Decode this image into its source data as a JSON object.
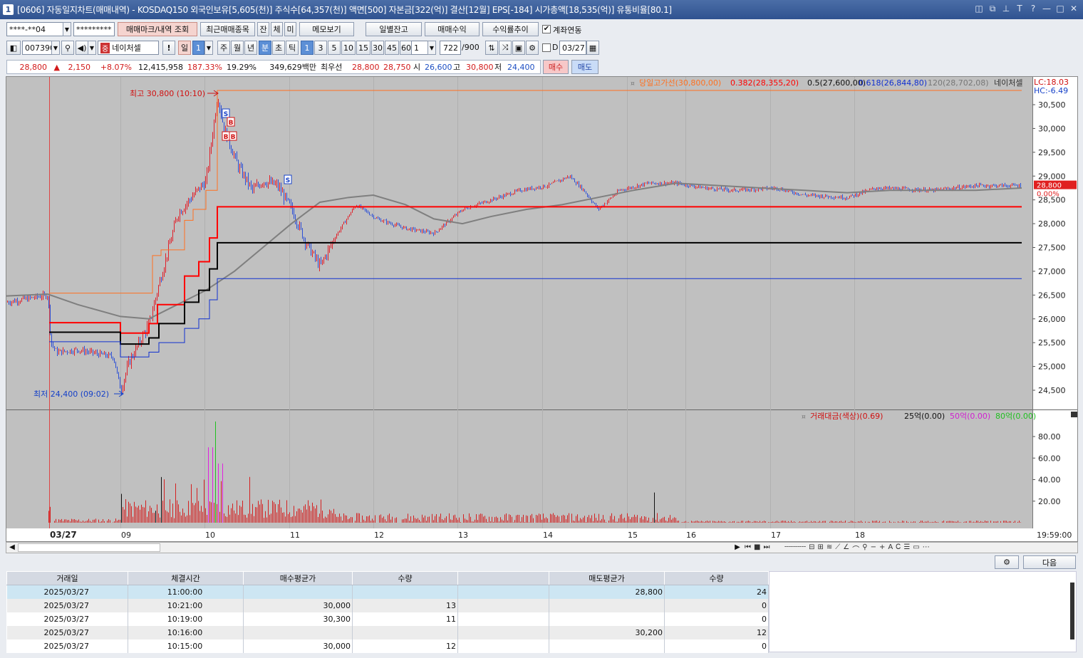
{
  "window": {
    "icon_label": "1",
    "title": "[0606] 자동일지차트(매매내역) - KOSDAQ150 외국인보유[5,605(천)] 주식수[64,357(천)] 액면[500] 자본금[322(억)] 결산[12월] EPS[-184] 시가총액[18,535(억)] 유통비율[80.1]"
  },
  "toolbar1": {
    "account": "****-**04",
    "password": "*********",
    "btn_mark": "매매마크/내역 조회",
    "btn_recent": "최근매매종목",
    "btn_jan": "잔",
    "btn_che": "체",
    "btn_mi": "미",
    "btn_memo": "메모보기",
    "btn_daily": "일별잔고",
    "btn_profit": "매매수익",
    "btn_trend": "수익률추이",
    "chk_link_label": "계좌연동",
    "chk_link_checked": "✔"
  },
  "toolbar2": {
    "code": "007390",
    "name_tag": "중",
    "name": "네이처셀",
    "excl": "!",
    "btn_day": "일",
    "day_n": "1",
    "btn_week": "주",
    "btn_month": "월",
    "btn_year": "년",
    "btn_min": "분",
    "btn_sec": "초",
    "btn_tick": "틱",
    "intervals": [
      "1",
      "3",
      "5",
      "10",
      "15",
      "30",
      "45",
      "60"
    ],
    "multi": "1",
    "count": "722",
    "count_max": "/900",
    "chk_d": "D",
    "date": "03/27"
  },
  "quote": {
    "price": "28,800",
    "change": "2,150",
    "arrow": "▲",
    "rate": "+8.07%",
    "volume": "12,415,958",
    "vol_rate": "187.33%",
    "turnover": "19.29%",
    "amount": "349,629백만",
    "best_label": "최우선",
    "ask": "28,800",
    "bid": "28,750",
    "open_label": "시",
    "open": "26,600",
    "high_label": "고",
    "high": "30,800",
    "low_label": "저",
    "low": "24,400",
    "buy_btn": "매수",
    "sell_btn": "매도"
  },
  "chart": {
    "top_legend": [
      "당일고가선(30,800,00)",
      "0.382(28,355,20)",
      "0.5(27,600,00)",
      "0.618(26,844,80)",
      "120(28,702,08)",
      "네이처셀"
    ],
    "legend_box": "¤",
    "lc": "LC:18.03",
    "hc": "HC:-6.49",
    "y_ticks": [
      "30,500",
      "30,000",
      "29,500",
      "29,000",
      "28,500",
      "28,000",
      "27,500",
      "27,000",
      "26,500",
      "26,000",
      "25,500",
      "25,000",
      "24,500"
    ],
    "cur_price_tag": "28,800",
    "cur_rate_tag": "0.00%",
    "high_note": "최고 30,800 (10:10)",
    "low_note": "최저 24,400 (09:02)",
    "mark_s": "S",
    "mark_b": "B",
    "vol_legend": [
      "거래대금(색상)(0.69)",
      "25억(0.00)",
      "50억(0.00)",
      "80억(0.00)"
    ],
    "vol_ticks": [
      "80.00",
      "60.00",
      "40.00",
      "20.00"
    ],
    "x_labels": [
      "03/27",
      "09",
      "10",
      "11",
      "12",
      "13",
      "14",
      "15",
      "16",
      "17",
      "18"
    ],
    "x_right": "19:59:00",
    "colors": {
      "bg": "#c0c0c0",
      "up": "#e0202a",
      "down": "#2c4fd6",
      "ma": "#7f7f7f",
      "fib382": "#ff0000",
      "fib5": "#000000",
      "fib618": "#1030d0",
      "high": "#ff7020",
      "vol": "#d42020"
    }
  },
  "bottom": {
    "next_btn": "다음",
    "gear_btn": "settings",
    "columns": [
      "거래일",
      "체결시간",
      "매수평균가",
      "수량",
      "",
      "매도평균가",
      "수량"
    ],
    "rows": [
      [
        "2025/03/27",
        "11:00:00",
        "",
        "",
        "",
        "28,800",
        "24"
      ],
      [
        "2025/03/27",
        "10:21:00",
        "30,000",
        "13",
        "",
        "",
        "0"
      ],
      [
        "2025/03/27",
        "10:19:00",
        "30,300",
        "11",
        "",
        "",
        "0"
      ],
      [
        "2025/03/27",
        "10:16:00",
        "",
        "",
        "",
        "30,200",
        "12"
      ],
      [
        "2025/03/27",
        "10:15:00",
        "30,000",
        "12",
        "",
        "",
        "0"
      ]
    ]
  }
}
